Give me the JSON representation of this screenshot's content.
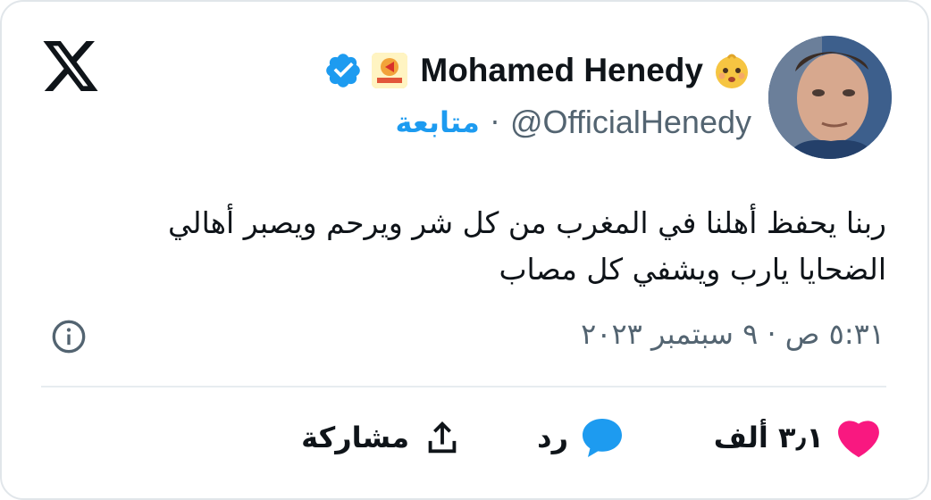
{
  "author": {
    "display_name": "Mohamed Henedy",
    "handle": "@OfficialHenedy",
    "separator": "·",
    "follow_label": "متابعة",
    "avatar_icon": "profile-photo",
    "verified_icon": "verified-badge-icon",
    "emoji_icon": "baby-face-emoji",
    "affiliate_badge_icon": "affiliate-badge"
  },
  "tweet": {
    "lines": [
      "ربنا يحفظ أهلنا في المغرب من كل شر  ويرحم ويصبر أهالي",
      "الضحايا يارب ويشفي كل مصاب"
    ],
    "timestamp": "٥:٣١ ص · ٩ سبتمبر ٢٠٢٣"
  },
  "actions": {
    "like_count": "٣٫١ ألف",
    "reply_label": "رد",
    "share_label": "مشاركة"
  },
  "colors": {
    "brand_blue": "#1d9bf0",
    "like_pink": "#f91880",
    "secondary_text": "#536471"
  }
}
